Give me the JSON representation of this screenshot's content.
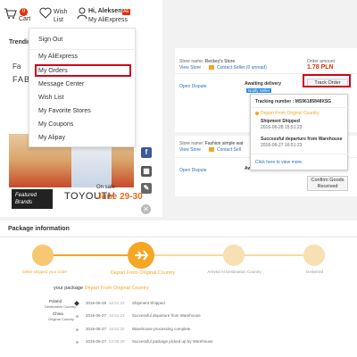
{
  "header": {
    "cart_count": "0",
    "cart_label": "Cart",
    "wish_label_1": "Wish",
    "wish_label_2": "List",
    "user_greeting": "Hi, Aleksen..",
    "user_badge": "AE",
    "user_sub": "My AliExpress",
    "trending": "Trendin",
    "fab": "FABL",
    "fa": "Fa"
  },
  "dropdown": {
    "items": [
      {
        "label": "Sign Out"
      },
      {
        "label": "My AliExpress"
      },
      {
        "label": "My Orders"
      },
      {
        "label": "Message Center"
      },
      {
        "label": "Wish List"
      },
      {
        "label": "My Favorite Stores"
      },
      {
        "label": "My Coupons"
      },
      {
        "label": "My Alipay"
      }
    ]
  },
  "banner": {
    "featured_1": "Featured",
    "featured_2": "Brands",
    "brand": "TOYOUTH",
    "on_sale": "On sale",
    "date": "June 29-30"
  },
  "social": {
    "fb": "f",
    "qr": "▦",
    "edit": "✎",
    "close": "✕"
  },
  "order1": {
    "store_label": "Store name:",
    "store_name": "Reckey's Store",
    "view_store": "View Store",
    "contact": "Contact Seller (0 unread)",
    "amount_label": "Order amount:",
    "amount": "1.78 PLN",
    "open_dispute": "Open Dispute",
    "status": "Awaiting delivery",
    "status_tag": "Notify Seller",
    "track_button": "Track Order"
  },
  "order2": {
    "store_label": "Store name:",
    "store_name": "Fashion simple wat",
    "view_store": "View Store",
    "contact": "Contact Sell",
    "open_dispute": "Open Dispute",
    "status": "Aw",
    "confirm_button_1": "Confirm Goods",
    "confirm_button_2": "Received"
  },
  "popup": {
    "tracking_label": "Tracking number : MS96185848XSG",
    "depart_label": "Depart From Original Country",
    "ev1_title": "Shipment Shipped",
    "ev1_time": "2016-06-28 15:51:23",
    "ev2_title": "Successful departure from Warehouse",
    "ev2_time": "2016-06-27 16:51:23",
    "more_link": "Click here to view more."
  },
  "package": {
    "title": "Package information",
    "steps": [
      {
        "label": "Seller shipped your order"
      },
      {
        "label": "Depart From Original Country"
      },
      {
        "label": "Arrived At Destination Country"
      },
      {
        "label": "Delivered"
      }
    ],
    "status_prefix": "your package",
    "status_value": "Depart From Original Country",
    "events": [
      {
        "place": "Poland",
        "sub": "Destination Country",
        "date": "2016-06-28",
        "time": "16:51:23",
        "desc": "Shipment Shipped"
      },
      {
        "place": "China",
        "sub": "Original Country",
        "date": "2016-06-27",
        "time": "16:51:23",
        "desc": "Successful departure from Warehouse"
      },
      {
        "place": "",
        "sub": "",
        "date": "2016-06-27",
        "time": "16:51:20",
        "desc": "Warehouse processing complete"
      },
      {
        "place": "",
        "sub": "",
        "date": "2016-06-27",
        "time": "03:58:29",
        "desc": "Successful package picked up by Warehouse"
      }
    ]
  },
  "colors": {
    "accent_red": "#e62e04",
    "highlight_box": "#d0021b",
    "link_blue": "#2c6ebb",
    "progress_orange": "#f5a623"
  }
}
